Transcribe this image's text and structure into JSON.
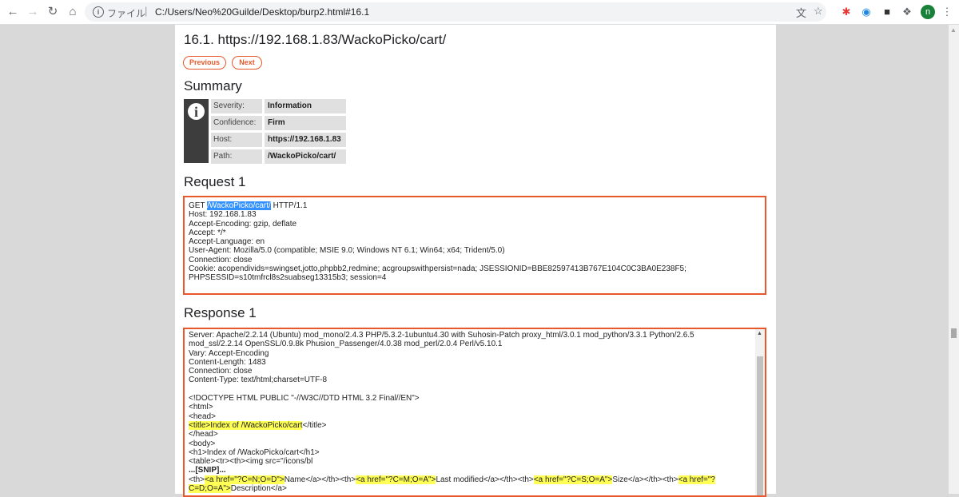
{
  "browser": {
    "scheme_label": "ファイル",
    "url": "C:/Users/Neo%20Guilde/Desktop/burp2.html#16.1",
    "avatar_letter": "n"
  },
  "page": {
    "title": "16.1. https://192.168.1.83/WackoPicko/cart/",
    "prev_label": "Previous",
    "next_label": "Next",
    "summary_heading": "Summary",
    "summary": [
      {
        "key": "Severity:",
        "value": "Information"
      },
      {
        "key": "Confidence:",
        "value": "Firm"
      },
      {
        "key": "Host:",
        "value": "https://192.168.1.83"
      },
      {
        "key": "Path:",
        "value": "/WackoPicko/cart/"
      }
    ],
    "request_heading": "Request 1",
    "request": {
      "method": "GET ",
      "path_selected": "/WackoPicko/cart/",
      "protocol": " HTTP/1.1",
      "lines": [
        "Host: 192.168.1.83",
        "Accept-Encoding: gzip, deflate",
        "Accept: */*",
        "Accept-Language: en",
        "User-Agent: Mozilla/5.0 (compatible; MSIE 9.0; Windows NT 6.1; Win64; x64; Trident/5.0)",
        "Connection: close",
        "Cookie: acopendivids=swingset,jotto,phpbb2,redmine; acgroupswithpersist=nada; JSESSIONID=BBE82597413B767E104C0C3BA0E238F5;",
        "PHPSESSID=s10tmfrcl8s2suabseg13315b3; session=4"
      ]
    },
    "response_heading": "Response 1",
    "response": {
      "header_lines": [
        "Server: Apache/2.2.14 (Ubuntu) mod_mono/2.4.3 PHP/5.3.2-1ubuntu4.30 with Suhosin-Patch proxy_html/3.0.1 mod_python/3.3.1 Python/2.6.5",
        "mod_ssl/2.2.14 OpenSSL/0.9.8k Phusion_Passenger/4.0.38 mod_perl/2.0.4 Perl/v5.10.1",
        "Vary: Accept-Encoding",
        "Content-Length: 1483",
        "Connection: close",
        "Content-Type: text/html;charset=UTF-8"
      ],
      "body_lines_a": [
        "<!DOCTYPE HTML PUBLIC \"-//W3C//DTD HTML 3.2 Final//EN\">",
        "<html>",
        "<head>"
      ],
      "title_hl": "<title>Index of /WackoPicko/cart",
      "title_rest": "</title>",
      "body_lines_b": [
        "</head>",
        "<body>",
        "<h1>Index of /WackoPicko/cart</h1>",
        "<table><tr><th><img src=\"/icons/bl"
      ],
      "snip": "...[SNIP]...",
      "th1": "<th>",
      "a1": "<a href=\"?C=N;O=D\">",
      "name": "Name",
      "mid1": "</a></th><th>",
      "a2": "<a href=\"?C=M;O=A\">",
      "lastmod": "Last modified",
      "mid2": "</a></th><th>",
      "a3": "<a href=\"?C=S;O=A\">",
      "size": "Size",
      "mid3": "</a></th><th>",
      "a4": "<a href=\"?",
      "a4b": "C=D;O=A\">",
      "desc": "Description</a>"
    }
  }
}
